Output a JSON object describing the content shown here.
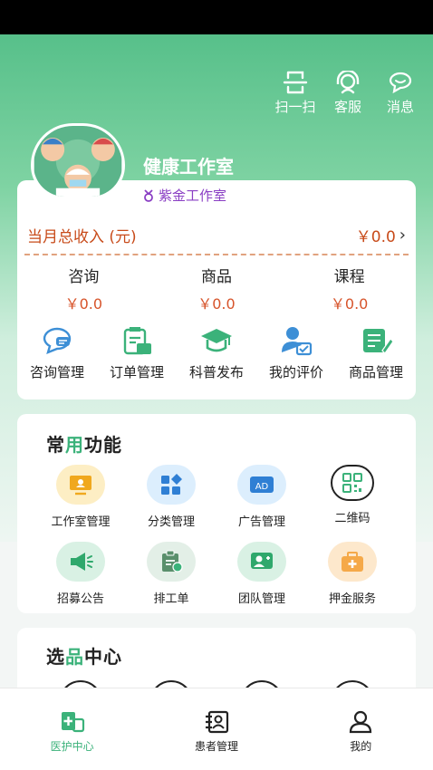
{
  "header": {
    "actions": [
      {
        "label": "扫一扫",
        "icon": "scan-icon"
      },
      {
        "label": "客服",
        "icon": "headset-icon"
      },
      {
        "label": "消息",
        "icon": "message-icon"
      }
    ]
  },
  "profile": {
    "studio_name": "健康工作室",
    "level": "紫金工作室"
  },
  "income": {
    "label": "当月总收入 (元)",
    "value": "￥0.0"
  },
  "stats": [
    {
      "name": "咨询",
      "value": "￥0.0"
    },
    {
      "name": "商品",
      "value": "￥0.0"
    },
    {
      "name": "课程",
      "value": "￥0.0"
    }
  ],
  "management": [
    {
      "label": "咨询管理",
      "icon": "chat-bubble-icon"
    },
    {
      "label": "订单管理",
      "icon": "order-icon"
    },
    {
      "label": "科普发布",
      "icon": "graduation-cap-icon"
    },
    {
      "label": "我的评价",
      "icon": "review-icon"
    },
    {
      "label": "商品管理",
      "icon": "product-icon"
    }
  ],
  "common_functions": {
    "title_prefix": "常",
    "title_highlight": "用",
    "title_suffix": "功能",
    "items": [
      {
        "label": "工作室管理",
        "icon": "monitor-icon"
      },
      {
        "label": "分类管理",
        "icon": "category-icon"
      },
      {
        "label": "广告管理",
        "icon": "ad-icon"
      },
      {
        "label": "二维码",
        "icon": "qr-code-icon"
      },
      {
        "label": "招募公告",
        "icon": "megaphone-icon"
      },
      {
        "label": "排工单",
        "icon": "schedule-icon"
      },
      {
        "label": "团队管理",
        "icon": "team-icon"
      },
      {
        "label": "押金服务",
        "icon": "medical-kit-icon"
      }
    ]
  },
  "selection_center": {
    "title_prefix": "选",
    "title_highlight": "品",
    "title_suffix": "中心"
  },
  "tabbar": [
    {
      "label": "医护中心",
      "icon": "medical-center-icon",
      "active": true
    },
    {
      "label": "患者管理",
      "icon": "patient-icon",
      "active": false
    },
    {
      "label": "我的",
      "icon": "user-icon",
      "active": false
    }
  ],
  "colors": {
    "accent": "#3bb27a",
    "income": "#c84b1a",
    "level": "#8a3fc4"
  }
}
